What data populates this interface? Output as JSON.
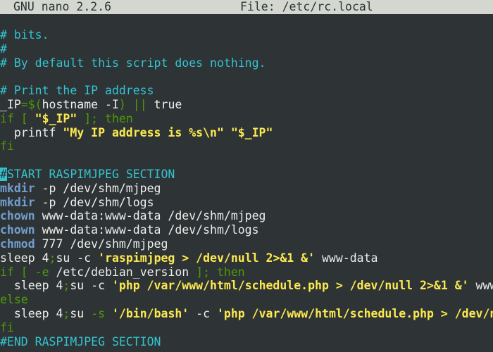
{
  "titlebar": {
    "app": "GNU nano 2.2.6",
    "file": "File: /etc/rc.local"
  },
  "lines": [
    [
      {
        "t": "# bits.",
        "c": "comment"
      }
    ],
    [
      {
        "t": "#",
        "c": "comment"
      }
    ],
    [
      {
        "t": "# By default this script does nothing.",
        "c": "comment"
      }
    ],
    [],
    [
      {
        "t": "# Print the IP address",
        "c": "comment"
      }
    ],
    [
      {
        "t": "_IP",
        "c": "plain"
      },
      {
        "t": "=$(",
        "c": "kw"
      },
      {
        "t": "hostname -I",
        "c": "plain"
      },
      {
        "t": ") || ",
        "c": "kw"
      },
      {
        "t": "true",
        "c": "plain"
      }
    ],
    [
      {
        "t": "if [ ",
        "c": "kw"
      },
      {
        "t": "\"$_IP\"",
        "c": "str"
      },
      {
        "t": " ]; then",
        "c": "kw"
      }
    ],
    [
      {
        "t": "  printf ",
        "c": "plain"
      },
      {
        "t": "\"My IP address is %s\\n\" \"$_IP\"",
        "c": "str"
      }
    ],
    [
      {
        "t": "fi",
        "c": "kw"
      }
    ],
    [],
    [
      {
        "t": "#",
        "c": "cursor"
      },
      {
        "t": "START RASPIMJPEG SECTION",
        "c": "comment"
      }
    ],
    [
      {
        "t": "mkdir",
        "c": "cmd"
      },
      {
        "t": " -p /dev/shm/mjpeg",
        "c": "plain"
      }
    ],
    [
      {
        "t": "mkdir",
        "c": "cmd"
      },
      {
        "t": " -p /dev/shm/logs",
        "c": "plain"
      }
    ],
    [
      {
        "t": "chown",
        "c": "cmd"
      },
      {
        "t": " www-data:www-data /dev/shm/mjpeg",
        "c": "plain"
      }
    ],
    [
      {
        "t": "chown",
        "c": "cmd"
      },
      {
        "t": " www-data:www-data /dev/shm/logs",
        "c": "plain"
      }
    ],
    [
      {
        "t": "chmod",
        "c": "cmd"
      },
      {
        "t": " 777 /dev/shm/mjpeg",
        "c": "plain"
      }
    ],
    [
      {
        "t": "sleep 4",
        "c": "plain"
      },
      {
        "t": ";",
        "c": "kw"
      },
      {
        "t": "su -c ",
        "c": "plain"
      },
      {
        "t": "'raspimjpeg > /dev/null 2>&1 &'",
        "c": "str"
      },
      {
        "t": " www-data",
        "c": "plain"
      }
    ],
    [
      {
        "t": "if [ -e ",
        "c": "kw"
      },
      {
        "t": "/etc/debian_version",
        "c": "plain"
      },
      {
        "t": " ]; then",
        "c": "kw"
      }
    ],
    [
      {
        "t": "  sleep 4",
        "c": "plain"
      },
      {
        "t": ";",
        "c": "kw"
      },
      {
        "t": "su -c ",
        "c": "plain"
      },
      {
        "t": "'php /var/www/html/schedule.php > /dev/null 2>&1 &'",
        "c": "str"
      },
      {
        "t": " www-da",
        "c": "plain"
      }
    ],
    [
      {
        "t": "else",
        "c": "kw"
      }
    ],
    [
      {
        "t": "  sleep 4",
        "c": "plain"
      },
      {
        "t": ";",
        "c": "kw"
      },
      {
        "t": "su ",
        "c": "plain"
      },
      {
        "t": "-s ",
        "c": "kw"
      },
      {
        "t": "'/bin/bash'",
        "c": "str"
      },
      {
        "t": " -c ",
        "c": "plain"
      },
      {
        "t": "'php /var/www/html/schedule.php > /dev/null",
        "c": "str"
      }
    ],
    [
      {
        "t": "fi",
        "c": "kw"
      }
    ],
    [
      {
        "t": "#END RASPIMJPEG SECTION",
        "c": "comment"
      }
    ]
  ],
  "colors": {
    "background": "#2e3436",
    "titlebar": "#d3d7cf",
    "comment": "#34c3cf",
    "keyword": "#4e9a06",
    "string": "#fce94f",
    "command": "#729fcf",
    "text": "#eeeeec"
  }
}
